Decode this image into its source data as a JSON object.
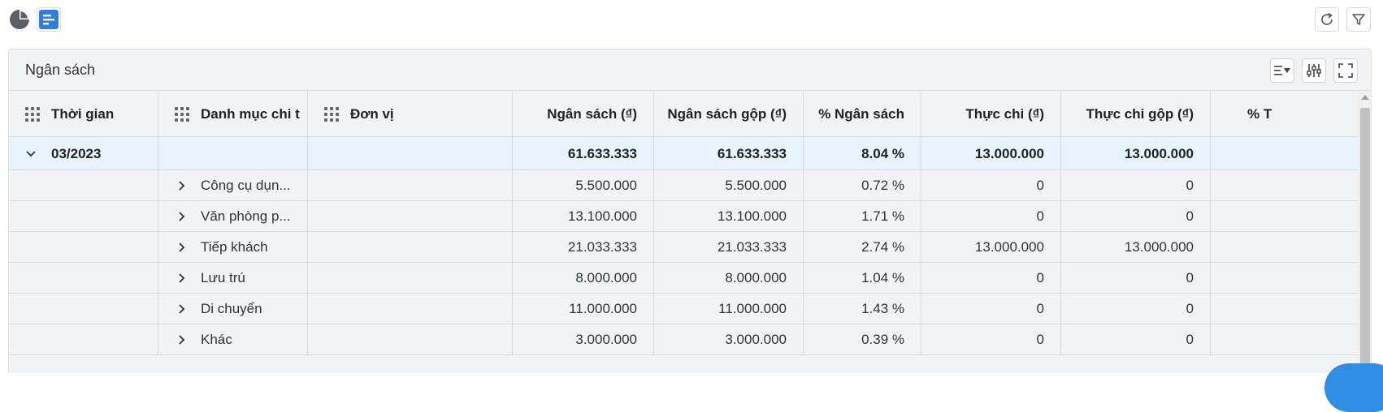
{
  "panel": {
    "title": "Ngân sách"
  },
  "columns": [
    {
      "label": "Thời gian"
    },
    {
      "label": "Danh mục chi t"
    },
    {
      "label": "Đơn vị"
    },
    {
      "label": "Ngân sách (₫)"
    },
    {
      "label": "Ngân sách gộp (₫)"
    },
    {
      "label": "% Ngân sách"
    },
    {
      "label": "Thực chi (₫)"
    },
    {
      "label": "Thực chi gộp (₫)"
    },
    {
      "label": "% T"
    }
  ],
  "group": {
    "period": "03/2023",
    "budget": "61.633.333",
    "budget_total": "61.633.333",
    "budget_pct": "8.04 %",
    "actual": "13.000.000",
    "actual_total": "13.000.000"
  },
  "rows": [
    {
      "category": "Công cụ dụn...",
      "budget": "5.500.000",
      "budget_total": "5.500.000",
      "budget_pct": "0.72 %",
      "actual": "0",
      "actual_total": "0"
    },
    {
      "category": "Văn phòng p...",
      "budget": "13.100.000",
      "budget_total": "13.100.000",
      "budget_pct": "1.71 %",
      "actual": "0",
      "actual_total": "0"
    },
    {
      "category": "Tiếp khách",
      "budget": "21.033.333",
      "budget_total": "21.033.333",
      "budget_pct": "2.74 %",
      "actual": "13.000.000",
      "actual_total": "13.000.000"
    },
    {
      "category": "Lưu trú",
      "budget": "8.000.000",
      "budget_total": "8.000.000",
      "budget_pct": "1.04 %",
      "actual": "0",
      "actual_total": "0"
    },
    {
      "category": "Di chuyển",
      "budget": "11.000.000",
      "budget_total": "11.000.000",
      "budget_pct": "1.43 %",
      "actual": "0",
      "actual_total": "0"
    },
    {
      "category": "Khác",
      "budget": "3.000.000",
      "budget_total": "3.000.000",
      "budget_pct": "0.39 %",
      "actual": "0",
      "actual_total": "0"
    }
  ],
  "icons": {
    "pie": "pie-chart-icon",
    "bar": "bar-list-icon",
    "refresh": "refresh-icon",
    "filter": "filter-icon",
    "sort": "sort-list-icon",
    "settings": "sliders-icon",
    "fullscreen": "fullscreen-icon"
  },
  "colors": {
    "accent": "#2f7de1",
    "group_row": "#e8f4fd",
    "panel_bg": "#f2f3f5"
  }
}
